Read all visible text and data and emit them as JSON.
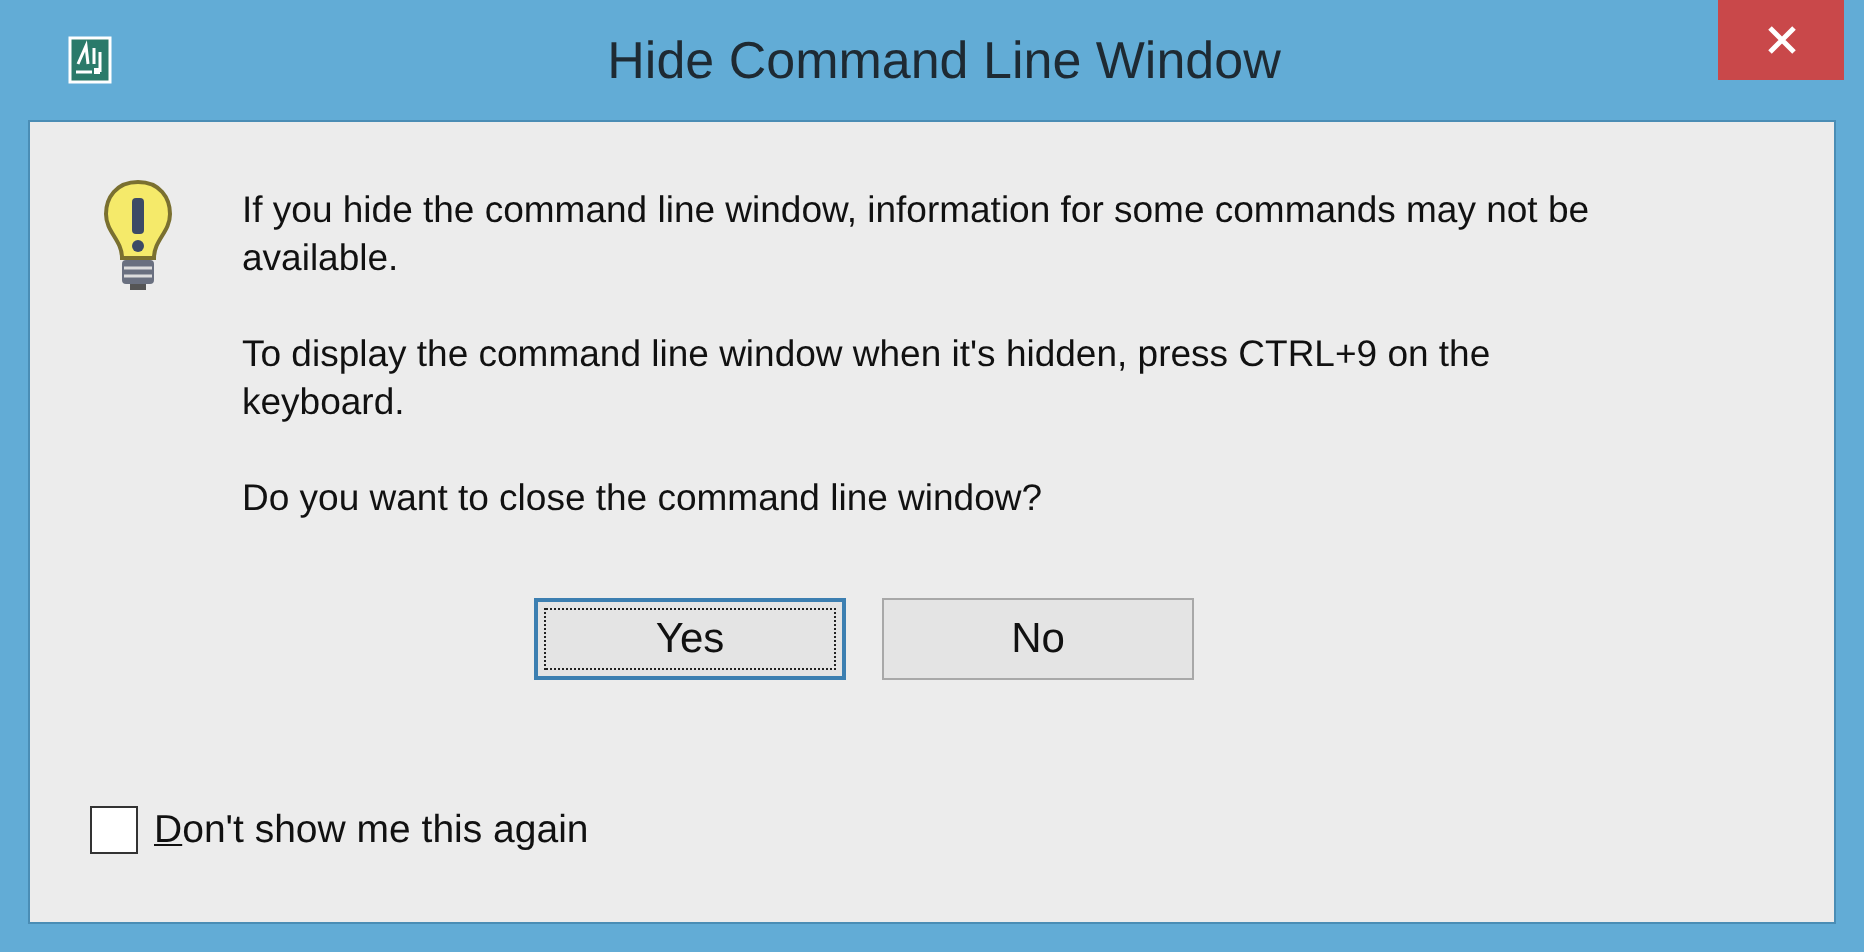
{
  "window": {
    "title": "Hide Command Line Window"
  },
  "message": [
    "If you hide the command line window, information for some commands may not be available.",
    "To display the command line window when it's hidden, press CTRL+9 on the keyboard.",
    "Do you want to close the command line window?"
  ],
  "buttons": [
    {
      "label": "Yes",
      "focused": true
    },
    {
      "label": "No",
      "focused": false
    }
  ],
  "checkbox": {
    "label": "Don't show me this again",
    "checked": false,
    "mnemonic_underlined": true
  }
}
